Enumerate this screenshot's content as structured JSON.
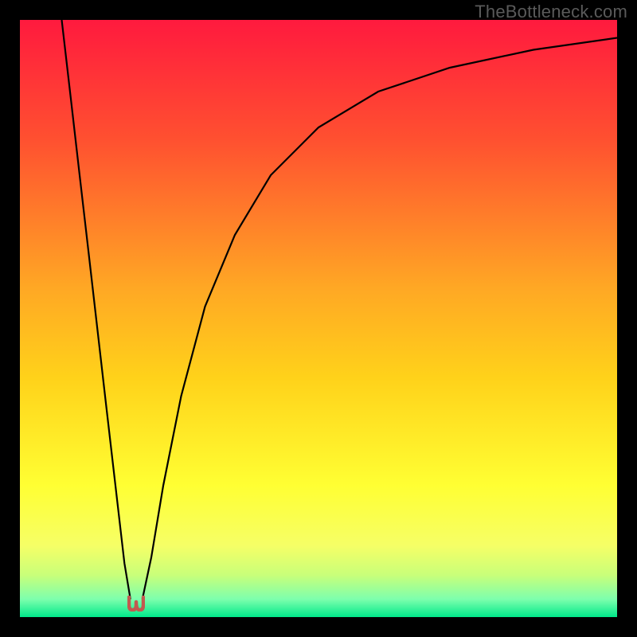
{
  "watermark": "TheBottleneck.com",
  "chart_data": {
    "type": "line",
    "title": "",
    "xlabel": "",
    "ylabel": "",
    "xlim": [
      0,
      100
    ],
    "ylim": [
      0,
      100
    ],
    "background_gradient": {
      "orientation": "vertical",
      "stops": [
        {
          "offset": 0.0,
          "color": "#ff1a3e"
        },
        {
          "offset": 0.2,
          "color": "#ff5030"
        },
        {
          "offset": 0.45,
          "color": "#ffa824"
        },
        {
          "offset": 0.6,
          "color": "#ffd21a"
        },
        {
          "offset": 0.78,
          "color": "#ffff33"
        },
        {
          "offset": 0.88,
          "color": "#f6ff66"
        },
        {
          "offset": 0.93,
          "color": "#c8ff7a"
        },
        {
          "offset": 0.97,
          "color": "#7dffad"
        },
        {
          "offset": 1.0,
          "color": "#00e88a"
        }
      ]
    },
    "series": [
      {
        "name": "left-branch",
        "x": [
          7.0,
          8.5,
          10.0,
          11.5,
          13.0,
          14.5,
          16.0,
          17.5,
          18.5
        ],
        "y": [
          100,
          87,
          74,
          61,
          48,
          35,
          22,
          9,
          3
        ]
      },
      {
        "name": "right-branch",
        "x": [
          20.5,
          22,
          24,
          27,
          31,
          36,
          42,
          50,
          60,
          72,
          86,
          100
        ],
        "y": [
          3,
          10,
          22,
          37,
          52,
          64,
          74,
          82,
          88,
          92,
          95,
          97
        ]
      }
    ],
    "marker": {
      "shape": "u",
      "color": "#c25a4f",
      "x": 19.5,
      "y": 1.5
    },
    "grid": false,
    "legend": false
  }
}
